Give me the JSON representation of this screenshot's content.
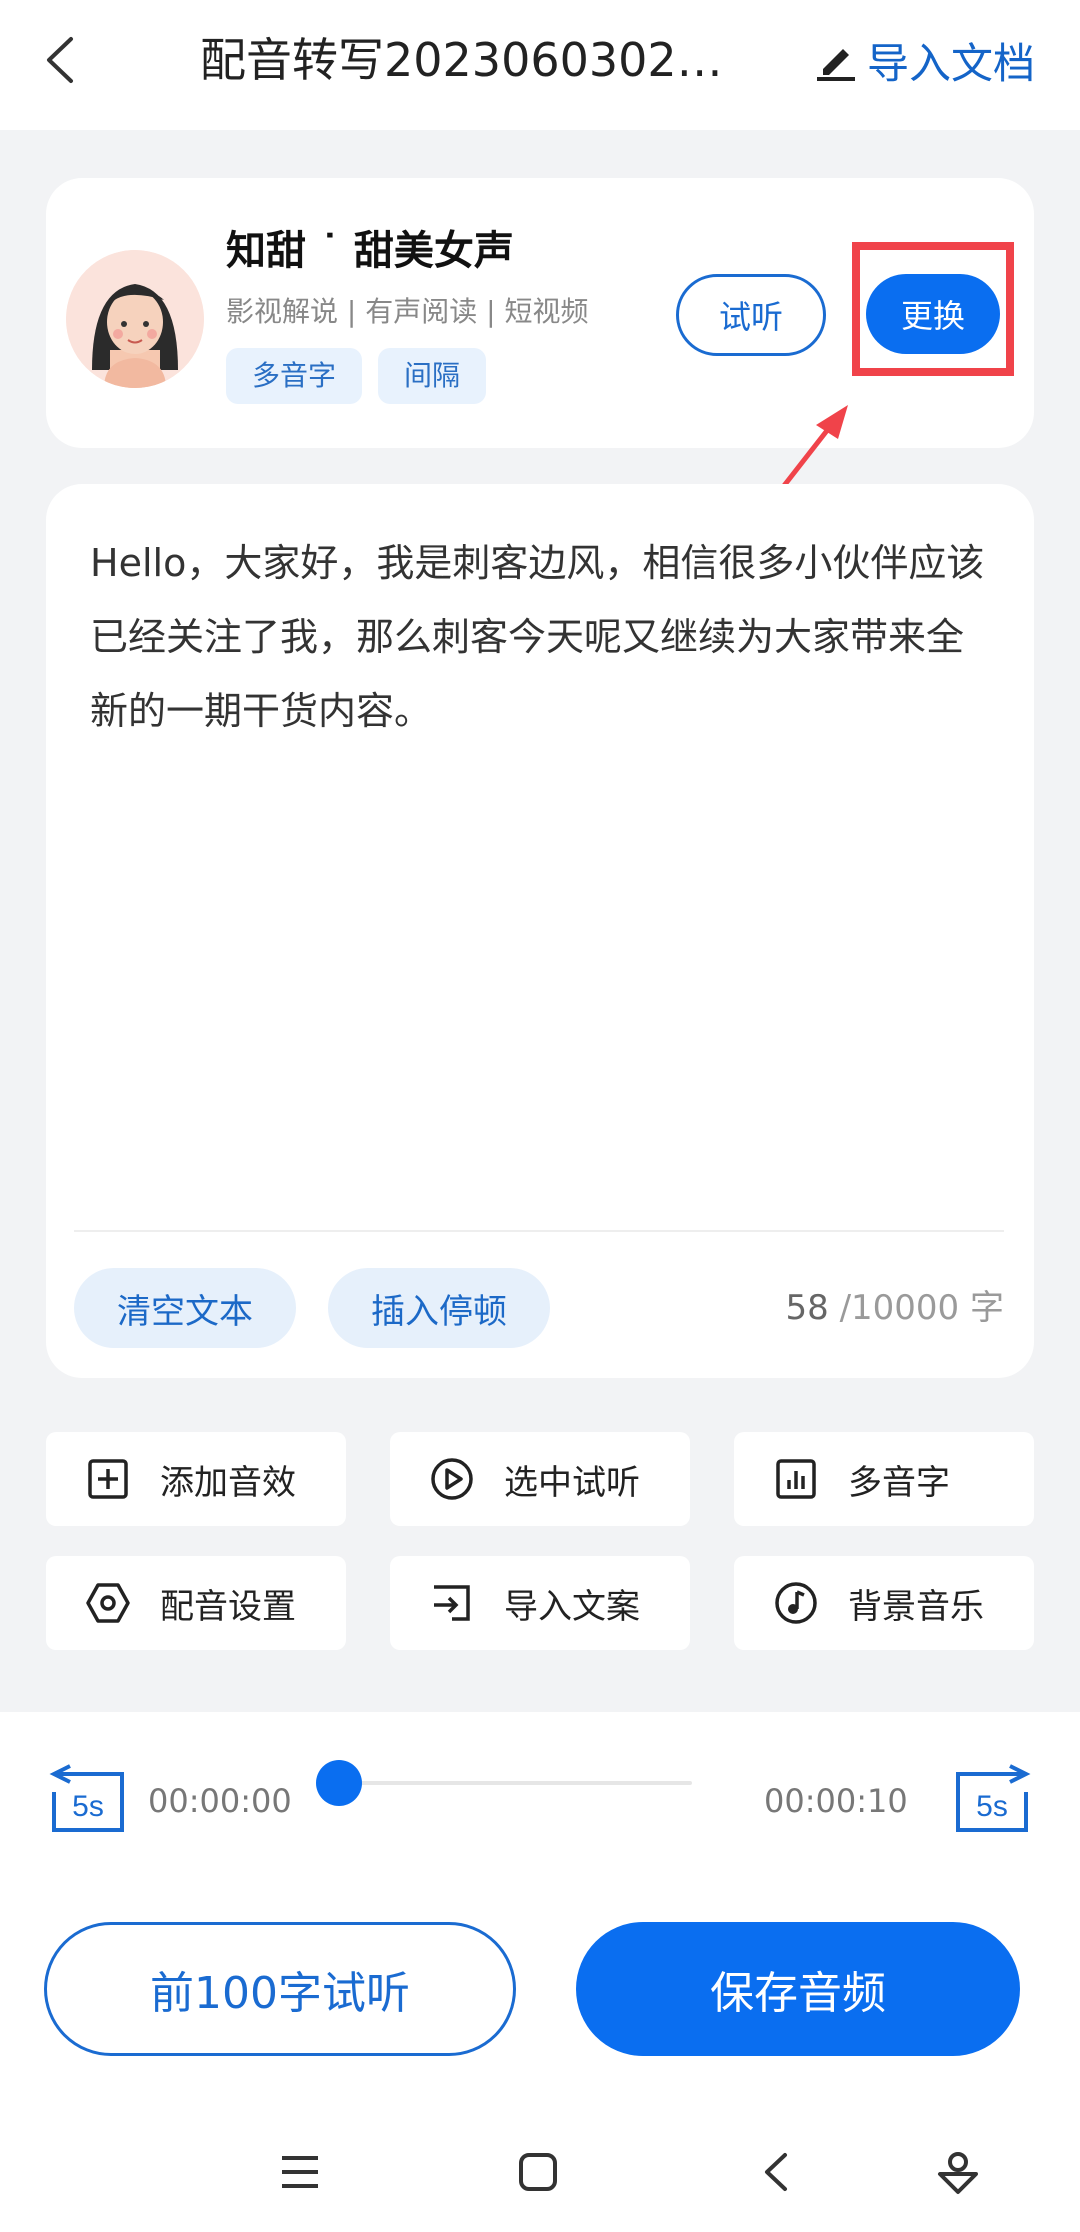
{
  "header": {
    "title": "配音转写2023060302…",
    "import_doc_label": "导入文档"
  },
  "voice": {
    "name": "知甜 ˙ 甜美女声",
    "tags": "影视解说 | 有声阅读 | 短视频",
    "chips": [
      "多音字",
      "间隔"
    ],
    "listen_label": "试听",
    "change_label": "更换"
  },
  "editor": {
    "text": "Hello，大家好，我是刺客边风，相信很多小伙伴应该已经关注了我，那么刺客今天呢又继续为大家带来全新的一期干货内容。",
    "clear_label": "清空文本",
    "insert_pause_label": "插入停顿",
    "count_current": "58",
    "count_total": " /10000 字"
  },
  "tools": [
    {
      "label": "添加音效",
      "icon": "plus-square-icon"
    },
    {
      "label": "选中试听",
      "icon": "play-circle-icon"
    },
    {
      "label": "多音字",
      "icon": "bar-chart-icon"
    },
    {
      "label": "配音设置",
      "icon": "hexagon-settings-icon"
    },
    {
      "label": "导入文案",
      "icon": "import-arrow-icon"
    },
    {
      "label": "背景音乐",
      "icon": "music-note-icon"
    }
  ],
  "player": {
    "current_time": "00:00:00",
    "total_time": "00:00:10",
    "back_skip_label": "5s",
    "forward_skip_label": "5s",
    "progress": 0
  },
  "actions": {
    "preview_label": "前100字试听",
    "save_label": "保存音频"
  },
  "colors": {
    "accent": "#0a6ef0",
    "highlight": "#f0434a"
  }
}
